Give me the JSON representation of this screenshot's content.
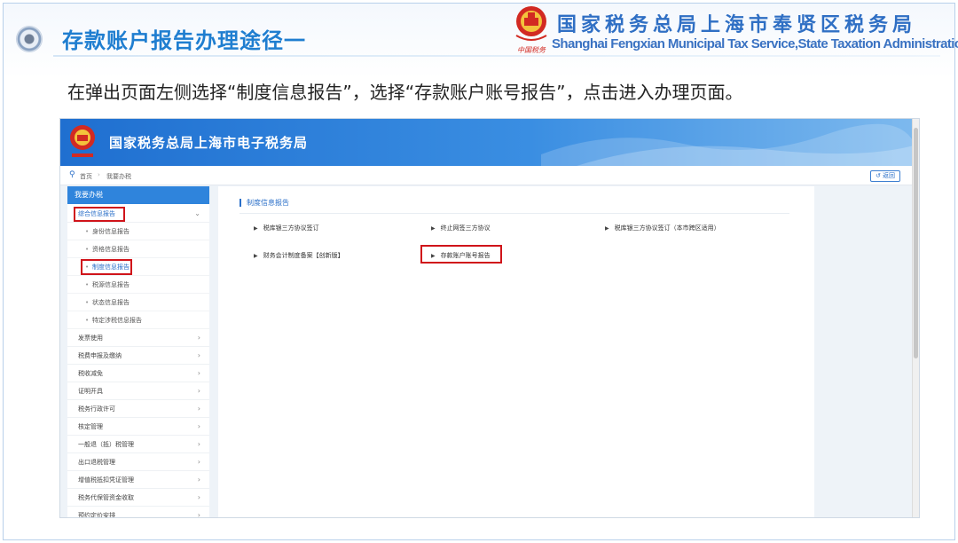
{
  "slide": {
    "title": "存款账户报告办理途径一",
    "org_cn": "国家税务总局上海市奉贤区税务局",
    "org_en": "Shanghai Fengxian Municipal Tax Service,State Taxation  Administration",
    "emblem_caption": "中国税务",
    "instruction": "在弹出页面左侧选择“制度信息报告”，选择“存款账户账号报告”，点击进入办理页面。"
  },
  "portal": {
    "title": "国家税务总局上海市电子税务局",
    "breadcrumb": [
      "首页",
      "我要办税"
    ],
    "breadcrumb_sep": "›",
    "back_label": "返回",
    "colors": {
      "header": "#1f6fd0",
      "accent": "#2f84dc",
      "highlight": "#d0141a"
    }
  },
  "sidebar": {
    "header": "我要办税",
    "group": {
      "label": "综合信息报告",
      "expanded": true
    },
    "subitems": [
      {
        "label": "身份信息报告"
      },
      {
        "label": "资格信息报告"
      },
      {
        "label": "制度信息报告",
        "highlighted": true
      },
      {
        "label": "税源信息报告"
      },
      {
        "label": "状态信息报告"
      },
      {
        "label": "特定涉税信息报告"
      }
    ],
    "items": [
      {
        "label": "发票使用"
      },
      {
        "label": "税费申报及缴纳"
      },
      {
        "label": "税收减免"
      },
      {
        "label": "证明开具"
      },
      {
        "label": "税务行政许可"
      },
      {
        "label": "核定管理"
      },
      {
        "label": "一般退（抵）税管理"
      },
      {
        "label": "出口退税管理"
      },
      {
        "label": "增值税抵扣凭证管理"
      },
      {
        "label": "税务代保管资金收取"
      },
      {
        "label": "预约定价安排"
      }
    ]
  },
  "content": {
    "section_title": "制度信息报告",
    "links": [
      {
        "label": "税库银三方协议签订"
      },
      {
        "label": "终止网签三方协议"
      },
      {
        "label": "税库银三方协议签订（本市跨区适用）"
      },
      {
        "label": "财务会计制度备案【创新版】"
      },
      {
        "label": "存款账户账号报告",
        "highlighted": true
      }
    ]
  }
}
